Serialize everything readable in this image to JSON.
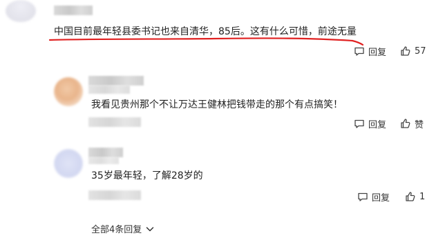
{
  "comments": [
    {
      "text": "中国目前最年轻县委书记也来自清华，85后。这有什么可惜，前途无量",
      "reply_label": "回复",
      "like_label": "57",
      "highlight_color": "#e02020"
    },
    {
      "text": "我看见贵州那个不让万达王健林把钱带走的那个有点搞笑！",
      "reply_label": "回复",
      "like_label": "赞"
    },
    {
      "text": "35岁最年轻，了解28岁的",
      "reply_label": "回复",
      "like_label": "1"
    }
  ],
  "expand_replies": {
    "label": "全部4条回复"
  },
  "icons": {
    "reply": "comment-icon",
    "like": "thumbs-up-icon",
    "expand": "chevron-down-icon"
  }
}
